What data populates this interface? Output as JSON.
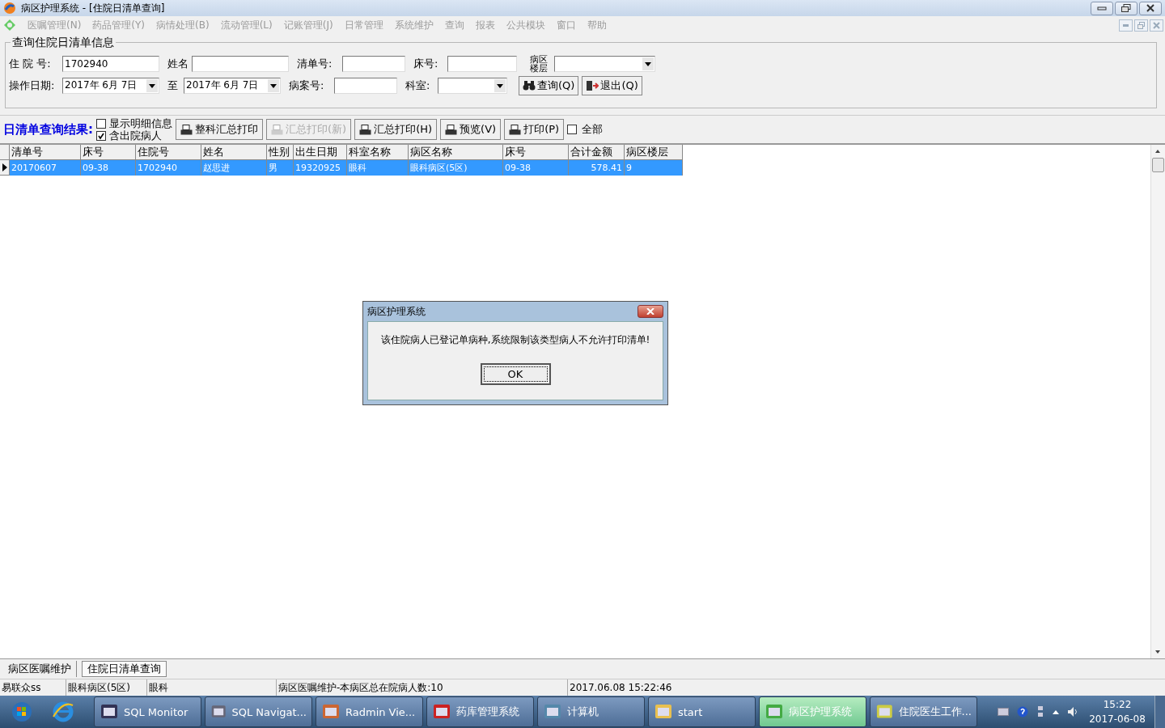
{
  "window": {
    "title": "病区护理系统 - [住院日清单查询]"
  },
  "menu": [
    {
      "label": "医嘱管理(N)",
      "disabled": true
    },
    {
      "label": "药品管理(Y)",
      "disabled": true
    },
    {
      "label": "病情处理(B)",
      "disabled": true
    },
    {
      "label": "流动管理(L)",
      "disabled": true
    },
    {
      "label": "记账管理(J)",
      "disabled": true
    },
    {
      "label": "日常管理",
      "disabled": true
    },
    {
      "label": "系统维护",
      "disabled": true
    },
    {
      "label": "查询",
      "disabled": true
    },
    {
      "label": "报表",
      "disabled": true
    },
    {
      "label": "公共模块",
      "disabled": true
    },
    {
      "label": "窗口",
      "disabled": true
    },
    {
      "label": "帮助",
      "disabled": true
    }
  ],
  "query": {
    "title": "查询住院日清单信息",
    "rows": [
      [
        {
          "kind": "text",
          "label": "住 院 号:",
          "value": "1702940"
        },
        {
          "kind": "text",
          "label": "姓名"
        },
        {
          "kind": "text",
          "label": "清单号:"
        },
        {
          "kind": "text",
          "label": "床号:"
        },
        {
          "kind": "select",
          "label": "病区楼层"
        }
      ],
      [
        {
          "kind": "date",
          "label": "操作日期:",
          "value": "2017年 6月 7日"
        },
        {
          "kind": "date",
          "label": "至",
          "value": "2017年 6月 7日"
        },
        {
          "kind": "text",
          "label": "病案号:"
        },
        {
          "kind": "select",
          "label": "科室:"
        },
        {
          "kind": "button",
          "label": "查询(Q)"
        },
        {
          "kind": "button",
          "label": "退出(Q)"
        }
      ]
    ]
  },
  "toolbar": [
    {
      "kind": "label",
      "label": "日清单查询结果:"
    },
    {
      "kind": "checks",
      "items": [
        {
          "label": "显示明细信息",
          "checked": false
        },
        {
          "label": "含出院病人",
          "checked": true
        }
      ]
    },
    {
      "kind": "button",
      "label": "整科汇总打印",
      "disabled": false
    },
    {
      "kind": "button",
      "label": "汇总打印(新)",
      "disabled": true
    },
    {
      "kind": "button",
      "label": "汇总打印(H)",
      "disabled": false
    },
    {
      "kind": "button",
      "label": "预览(V)",
      "disabled": false
    },
    {
      "kind": "button",
      "label": "打印(P)",
      "disabled": false
    },
    {
      "kind": "check",
      "label": "全部",
      "checked": false
    }
  ],
  "table": {
    "columns": [
      "清单号",
      "床号",
      "住院号",
      "姓名",
      "性别",
      "出生日期",
      "科室名称",
      "病区名称",
      "床号",
      "合计金额",
      "病区楼层"
    ],
    "rows": [
      {
        "selected": true,
        "cells": [
          "20170607",
          "09-38",
          "1702940",
          "赵思进",
          "男",
          "19320925",
          "眼科",
          "眼科病区(5区)",
          "09-38",
          "578.41",
          "9"
        ]
      }
    ]
  },
  "dialog": {
    "title": "病区护理系统",
    "message": "该住院病人已登记单病种,系统限制该类型病人不允许打印清单!",
    "button": "OK"
  },
  "tabs": [
    {
      "label": "病区医嘱维护",
      "selected": false
    },
    {
      "label": "住院日清单查询",
      "selected": true
    }
  ],
  "status_bar": [
    "易联众ss",
    "眼科病区(5区)",
    "眼科",
    "病区医嘱维护-本病区总在院病人数:10",
    "2017.06.08 15:22:46"
  ],
  "taskbar": {
    "items": [
      {
        "label": "SQL Monitor",
        "active": false
      },
      {
        "label": "SQL Navigat...",
        "active": false
      },
      {
        "label": "Radmin Vie...",
        "active": false
      },
      {
        "label": "药库管理系统",
        "active": false
      },
      {
        "label": "计算机",
        "active": false
      },
      {
        "label": "start",
        "active": false
      },
      {
        "label": "病区护理系统",
        "active": true
      },
      {
        "label": "住院医生工作...",
        "active": false
      }
    ],
    "time": "15:22",
    "date": "2017-06-08"
  }
}
